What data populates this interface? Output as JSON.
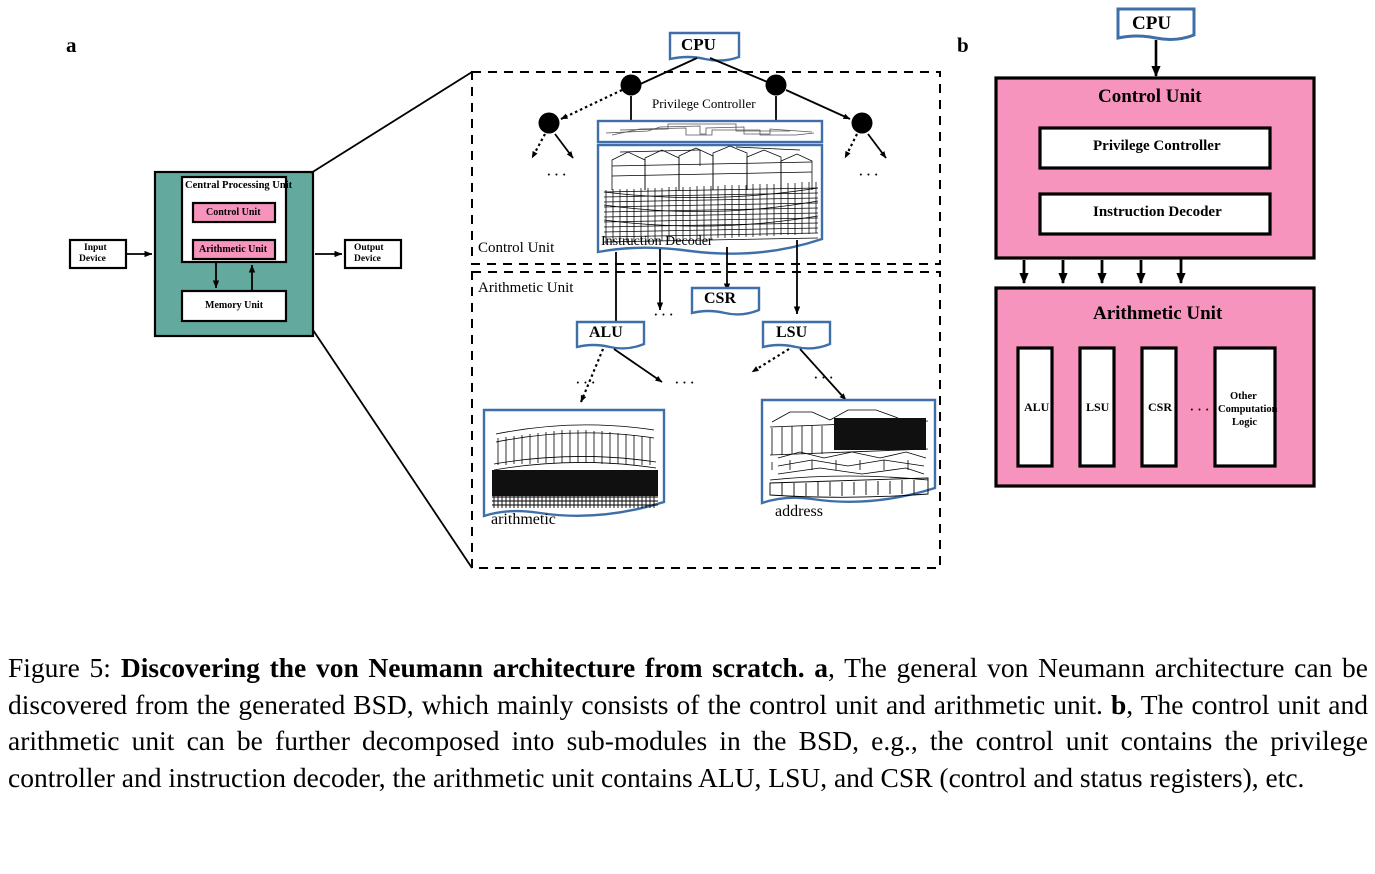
{
  "figure": {
    "panel_a_letter": "a",
    "panel_b_letter": "b",
    "caption_label": "Figure 5:",
    "caption_bold": "Discovering the von Neumann architecture from scratch.",
    "caption_a_marker": "a",
    "caption_a_text": ", The general von Neumann architecture can be discovered from the generated BSD, which mainly consists of the control unit and arithmetic unit. ",
    "caption_b_marker": "b",
    "caption_b_text": ", The control unit and arithmetic unit can be further decomposed into sub-modules in the BSD, e.g., the control unit contains the privilege controller and instruction decoder, the arithmetic unit contains ALU, LSU, and CSR (control and status registers), etc."
  },
  "colors": {
    "pink": "#F794BD",
    "teal": "#63A99E",
    "blue_outline": "#3F6FA8",
    "black": "#000000",
    "white": "#FFFFFF"
  },
  "panel_a": {
    "von_neumann": {
      "input_device": "Input\nDevice",
      "input_device_line1": "Input",
      "input_device_line2": "Device",
      "output_device_line1": "Output",
      "output_device_line2": "Device",
      "cpu_box_label": "Central Processing Unit",
      "control_unit": "Control Unit",
      "arithmetic_unit": "Arithmetic Unit",
      "memory_unit": "Memory Unit"
    },
    "bsd": {
      "root_node": "CPU",
      "control_unit_region": "Control Unit",
      "arithmetic_unit_region": "Arithmetic Unit",
      "privilege_controller": "Privilege Controller",
      "instruction_decoder": "Instruction Decoder",
      "csr": "CSR",
      "alu": "ALU",
      "lsu": "LSU",
      "arithmetic_leaf": "arithmetic",
      "address_leaf": "address",
      "ellipsis": "···"
    }
  },
  "panel_b": {
    "cpu": "CPU",
    "control_unit": {
      "title": "Control Unit",
      "sub_modules": [
        "Privilege Controller",
        "Instruction Decoder"
      ]
    },
    "arithmetic_unit": {
      "title": "Arithmetic Unit",
      "sub_modules": [
        "ALU",
        "LSU",
        "CSR"
      ],
      "ellipsis": "···",
      "other_line1": "Other",
      "other_line2": "Computation",
      "other_line3": "Logic"
    }
  },
  "chart_data": {
    "type": "diagram",
    "title": "Discovering the von Neumann architecture from scratch",
    "panels": [
      {
        "id": "a",
        "nodes": [
          "Input Device",
          "Central Processing Unit",
          "Control Unit",
          "Arithmetic Unit",
          "Memory Unit",
          "Output Device",
          "CPU",
          "Privilege Controller",
          "Instruction Decoder",
          "CSR",
          "ALU",
          "LSU",
          "arithmetic",
          "address"
        ],
        "regions": [
          "Control Unit",
          "Arithmetic Unit"
        ]
      },
      {
        "id": "b",
        "nodes": [
          "CPU",
          "Control Unit",
          "Privilege Controller",
          "Instruction Decoder",
          "Arithmetic Unit",
          "ALU",
          "LSU",
          "CSR",
          "Other Computation Logic"
        ]
      }
    ]
  }
}
